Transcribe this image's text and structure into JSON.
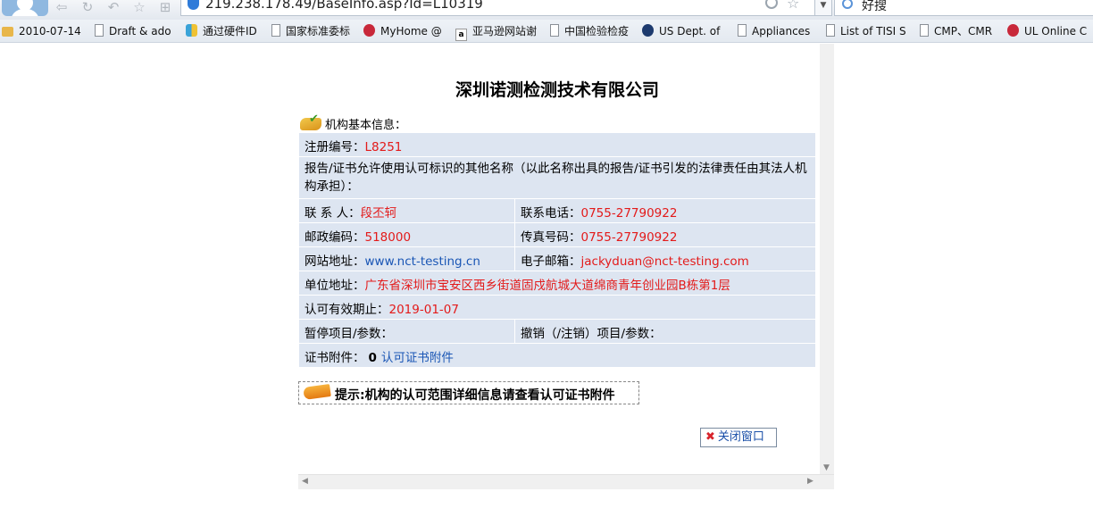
{
  "browser": {
    "url": "219.238.178.49/BaseInfo.asp?Id=L10319",
    "search_text": "好搜",
    "bookmarks": [
      {
        "label": "2010-07-14",
        "icon": "folder-icon"
      },
      {
        "label": "Draft & ado",
        "icon": "page-icon"
      },
      {
        "label": "通过硬件ID",
        "icon": "site-icon"
      },
      {
        "label": "国家标准委标",
        "icon": "page-icon"
      },
      {
        "label": "MyHome @",
        "icon": "ul-icon"
      },
      {
        "label": "亚马逊网站谢",
        "icon": "amazon-icon"
      },
      {
        "label": "中国检验检疫",
        "icon": "page-icon"
      },
      {
        "label": "US Dept. of",
        "icon": "seal-icon"
      },
      {
        "label": "Appliances",
        "icon": "page-icon"
      },
      {
        "label": "List of TISI S",
        "icon": "page-icon"
      },
      {
        "label": "CMP、CMR",
        "icon": "page-icon"
      },
      {
        "label": "UL Online C",
        "icon": "ul-icon"
      }
    ]
  },
  "page": {
    "company": "深圳诺测检测技术有限公司",
    "section_title": "机构基本信息：",
    "reg_label": "注册编号：",
    "reg_value": "L8251",
    "other_names": "报告/证书允许使用认可标识的其他名称（以此名称出具的报告/证书引发的法律责任由其法人机构承担）：",
    "contact_label": "联 系 人：",
    "contact_value": "段丕轲",
    "phone_label": "联系电话：",
    "phone_value": "0755-27790922",
    "zip_label": "邮政编码：",
    "zip_value": "518000",
    "fax_label": "传真号码：",
    "fax_value": "0755-27790922",
    "web_label": "网站地址：",
    "web_value": "www.nct-testing.cn",
    "email_label": "电子邮箱：",
    "email_value": "jackyduan@nct-testing.com",
    "addr_label": "单位地址：",
    "addr_value": "广东省深圳市宝安区西乡街道固戍航城大道绵商青年创业园B栋第1层",
    "valid_label": "认可有效期止：",
    "valid_value": "2019-01-07",
    "suspended_label": "暂停项目/参数：",
    "revoked_label": "撤销（/注销）项目/参数：",
    "attach_label": "证书附件：",
    "attach_count": "0",
    "attach_link": "认可证书附件",
    "tip": "提示:机构的认可范围详细信息请查看认可证书附件",
    "close_button": "关闭窗口"
  }
}
